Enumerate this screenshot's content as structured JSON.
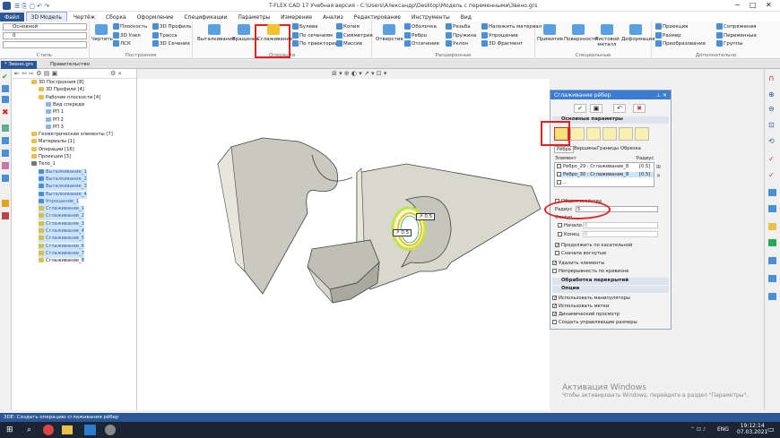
{
  "window": {
    "title": "T-FLEX CAD 17 Учебная версия - C:\\Users\\Александр\\Desktop\\Модель с переменными\\Звено.grs"
  },
  "menu": [
    "Файл",
    "3D Модель",
    "Чертёж",
    "Сборка",
    "Оформление",
    "Спецификации",
    "Параметры",
    "Измерение",
    "Анализ",
    "Редактирование",
    "Инструменты",
    "Вид"
  ],
  "ribbon": {
    "style": {
      "combo1": "Основной",
      "combo2": "0",
      "label": "Стиль"
    },
    "build": {
      "items": [
        "Чертить",
        "Плоскость",
        "3D Узел",
        "ЛСК",
        "3D Профиль",
        "Трасса",
        "3D Сечение"
      ],
      "label": "Построения"
    },
    "ops": {
      "items": [
        "Выталкивание",
        "Вращение",
        "Сглаживание",
        "Булева",
        "По сечениям",
        "По траектории",
        "Копия",
        "Симметрия",
        "Массив"
      ],
      "label": "Операции"
    },
    "ext": {
      "items": [
        "Отверстие",
        "Оболочка",
        "Ребро",
        "Отсечение",
        "Резьба",
        "Пружина",
        "Уклон",
        "Наложить материал",
        "Упрощение",
        "3D Фрагмент"
      ],
      "label": "Расширенные"
    },
    "special": {
      "items": [
        "Примитив",
        "Поверхности",
        "Листовой металл",
        "Деформация"
      ],
      "label": "Специальные"
    },
    "extra": {
      "items": [
        "Проекция",
        "Размер",
        "Преобразование",
        "Сопряжения",
        "Переменные",
        "Группы"
      ],
      "label": "Дополнительно"
    }
  },
  "doctabs": {
    "active": "* Звено.grs",
    "other": "Правительство"
  },
  "tree": [
    {
      "label": "3D Построения [8]",
      "level": 1,
      "type": "folder"
    },
    {
      "label": "3D Профили [4]",
      "level": 2,
      "type": "folder"
    },
    {
      "label": "Рабочие плоскости [4]",
      "level": 2,
      "type": "folder"
    },
    {
      "label": "Вид спереди",
      "level": 3,
      "type": "plane"
    },
    {
      "label": "РП 1",
      "level": 3,
      "type": "plane"
    },
    {
      "label": "РП 2",
      "level": 3,
      "type": "plane"
    },
    {
      "label": "РП 3",
      "level": 3,
      "type": "plane"
    },
    {
      "label": "Геометрические элементы [7]",
      "level": 1,
      "type": "folder"
    },
    {
      "label": "Материалы [1]",
      "level": 1,
      "type": "folder"
    },
    {
      "label": "Операции [16]",
      "level": 1,
      "type": "folder"
    },
    {
      "label": "Проекции [3]",
      "level": 1,
      "type": "folder"
    },
    {
      "label": "Тело_1",
      "level": 1,
      "type": "body"
    },
    {
      "label": "Выталкивание_1",
      "level": 2,
      "type": "op",
      "blue": true
    },
    {
      "label": "Выталкивание_2",
      "level": 2,
      "type": "op",
      "blue": true
    },
    {
      "label": "Выталкивание_3",
      "level": 2,
      "type": "op",
      "blue": true
    },
    {
      "label": "Выталкивание_4",
      "level": 2,
      "type": "op",
      "blue": true
    },
    {
      "label": "Упрощение_1",
      "level": 2,
      "type": "op",
      "blue": true
    },
    {
      "label": "Сглаживание_1",
      "level": 2,
      "type": "op",
      "blue": true
    },
    {
      "label": "Сглаживание_2",
      "level": 2,
      "type": "op",
      "blue": true
    },
    {
      "label": "Сглаживание_3",
      "level": 2,
      "type": "op",
      "blue": true
    },
    {
      "label": "Сглаживание_4",
      "level": 2,
      "type": "op",
      "blue": true
    },
    {
      "label": "Сглаживание_5",
      "level": 2,
      "type": "op",
      "blue": true
    },
    {
      "label": "Сглаживание_6",
      "level": 2,
      "type": "op",
      "blue": true
    },
    {
      "label": "Сглаживание_7",
      "level": 2,
      "type": "op",
      "blue": true
    },
    {
      "label": "Сглаживание_8",
      "level": 2,
      "type": "op",
      "blue": false
    }
  ],
  "viewport": {
    "tag1": "0.5",
    "tag2": "0.5"
  },
  "panel": {
    "title": "Сглаживание рёбер",
    "section_main": "Основные параметры",
    "tabs": [
      "Рёбра",
      "Вершины",
      "Границы",
      "Обрезка"
    ],
    "col_element": "Элемент",
    "col_radius": "Радиус",
    "rows": [
      {
        "element": "Ребро_29 : Сглаживание_8",
        "radius": "[0.5]"
      },
      {
        "element": "Ребро_30 : Сглаживание_8",
        "radius": "[0.5]"
      },
      {
        "element": "...",
        "radius": ""
      }
    ],
    "common_props": "Общие свойства",
    "radius_label": "Радиус",
    "radius_value": "5",
    "offset_label": "Отступ",
    "start_label": "Начало",
    "start_value": "0",
    "end_label": "Конец",
    "end_value": "0",
    "opt1": "Продолжить по касательной",
    "opt2": "Сначала вогнутые",
    "opt3": "Удалить элементы",
    "opt4": "Непрерывность по кривизне",
    "section_overlap": "Обработка перекрытий",
    "section_options": "Опции",
    "opt5": "Использовать манипуляторы",
    "opt6": "Использовать метки",
    "opt7": "Динамический просмотр",
    "opt8": "Создать управляющие размеры"
  },
  "status": "3DE: Создать операцию сглаживания рёбер",
  "activation": {
    "line1": "Активация Windows",
    "line2": "Чтобы активировать Windows, перейдите в раздел \"Параметры\"."
  },
  "taskbar": {
    "lang": "ENG",
    "time": "19:12:14",
    "date": "07.03.2021"
  }
}
